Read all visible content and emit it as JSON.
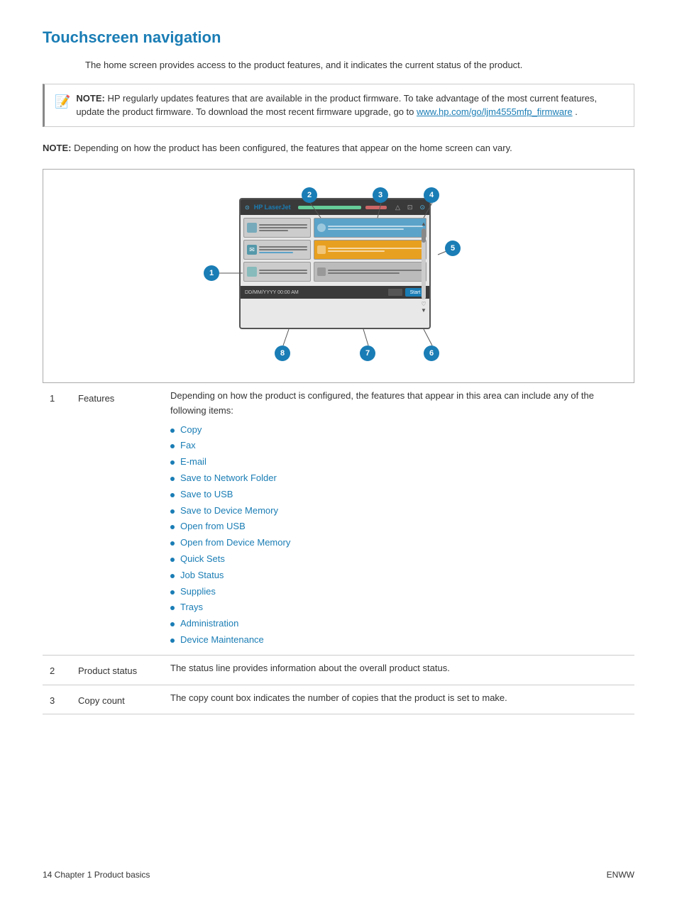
{
  "page": {
    "title": "Touchscreen navigation",
    "intro": "The home screen provides access to the product features, and it indicates the current status of the product.",
    "note1": {
      "label": "NOTE:",
      "text": "HP regularly updates features that are available in the product firmware. To take advantage of the most current features, update the product firmware. To download the most recent firmware upgrade, go to ",
      "link_text": "www.hp.com/go/ljm4555mfp_firmware",
      "link_url": "www.hp.com/go/ljm4555mfp_firmware",
      "text_end": "."
    },
    "note2": {
      "label": "NOTE:",
      "text": "Depending on how the product has been configured, the features that appear on the home screen can vary."
    },
    "callouts": [
      "1",
      "2",
      "3",
      "4",
      "5",
      "6",
      "7",
      "8"
    ],
    "table": {
      "rows": [
        {
          "num": "1",
          "col2": "Features",
          "col3_intro": "Depending on how the product is configured, the features that appear in this area can include any of the following items:",
          "items": [
            "Copy",
            "Fax",
            "E-mail",
            "Save to Network Folder",
            "Save to USB",
            "Save to Device Memory",
            "Open from USB",
            "Open from Device Memory",
            "Quick Sets",
            "Job Status",
            "Supplies",
            "Trays",
            "Administration",
            "Device Maintenance"
          ]
        },
        {
          "num": "2",
          "col2": "Product status",
          "col3_intro": "The status line provides information about the overall product status.",
          "items": []
        },
        {
          "num": "3",
          "col2": "Copy count",
          "col3_intro": "The copy count box indicates the number of copies that the product is set to make.",
          "items": []
        }
      ]
    },
    "footer": {
      "left": "14    Chapter 1    Product basics",
      "right": "ENWW"
    }
  }
}
